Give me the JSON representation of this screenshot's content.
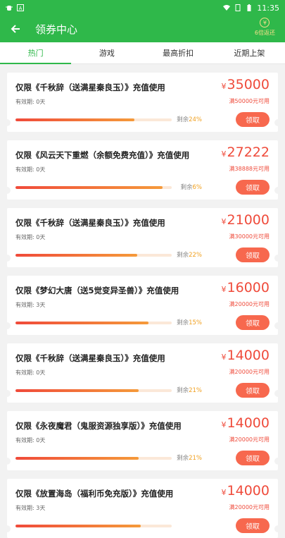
{
  "statusbar": {
    "time": "11:35",
    "left_icons": [
      "bug-icon",
      "a-icon"
    ],
    "right_icons": [
      "wifi-icon",
      "sim-icon",
      "battery-icon"
    ]
  },
  "header": {
    "title": "领券中心",
    "rebate_label": "6倍返还",
    "rebate_icon": "yen-cycle-icon",
    "accent": "#2fb84a"
  },
  "tabs": [
    {
      "label": "热门",
      "active": true
    },
    {
      "label": "游戏",
      "active": false
    },
    {
      "label": "最高折扣",
      "active": false
    },
    {
      "label": "近期上架",
      "active": false
    }
  ],
  "coupon_strings": {
    "remain_prefix": "剩余",
    "currency": "¥",
    "claim": "领取"
  },
  "coupons": [
    {
      "title": "仅限《千秋辞（送满星秦良玉）》充值使用",
      "valid": "有效期: 0天",
      "remain": "24%",
      "remain_fraction": 0.76,
      "price": "35000",
      "condition": "满50000元可用"
    },
    {
      "title": "仅限《风云天下重燃（余额免费充值）》充值使用",
      "valid": "有效期: 0天",
      "remain": "6%",
      "remain_fraction": 0.94,
      "price": "27222",
      "condition": "满38888元可用"
    },
    {
      "title": "仅限《千秋辞（送满星秦良玉）》充值使用",
      "valid": "有效期: 0天",
      "remain": "22%",
      "remain_fraction": 0.78,
      "price": "21000",
      "condition": "满30000元可用"
    },
    {
      "title": "仅限《梦幻大唐（送5觉变异圣兽）》充值使用",
      "valid": "有效期: 3天",
      "remain": "15%",
      "remain_fraction": 0.85,
      "price": "16000",
      "condition": "满20000元可用"
    },
    {
      "title": "仅限《千秋辞（送满星秦良玉）》充值使用",
      "valid": "有效期: 0天",
      "remain": "21%",
      "remain_fraction": 0.79,
      "price": "14000",
      "condition": "满20000元可用"
    },
    {
      "title": "仅限《永夜魔君（鬼服资源独享版）》充值使用",
      "valid": "有效期: 0天",
      "remain": "21%",
      "remain_fraction": 0.79,
      "price": "14000",
      "condition": "满20000元可用"
    },
    {
      "title": "仅限《放置海岛（福利币免充版）》充值使用",
      "valid": "有效期: 3天",
      "remain": "",
      "remain_fraction": 0.8,
      "price": "14000",
      "condition": "满20000元可用"
    }
  ]
}
